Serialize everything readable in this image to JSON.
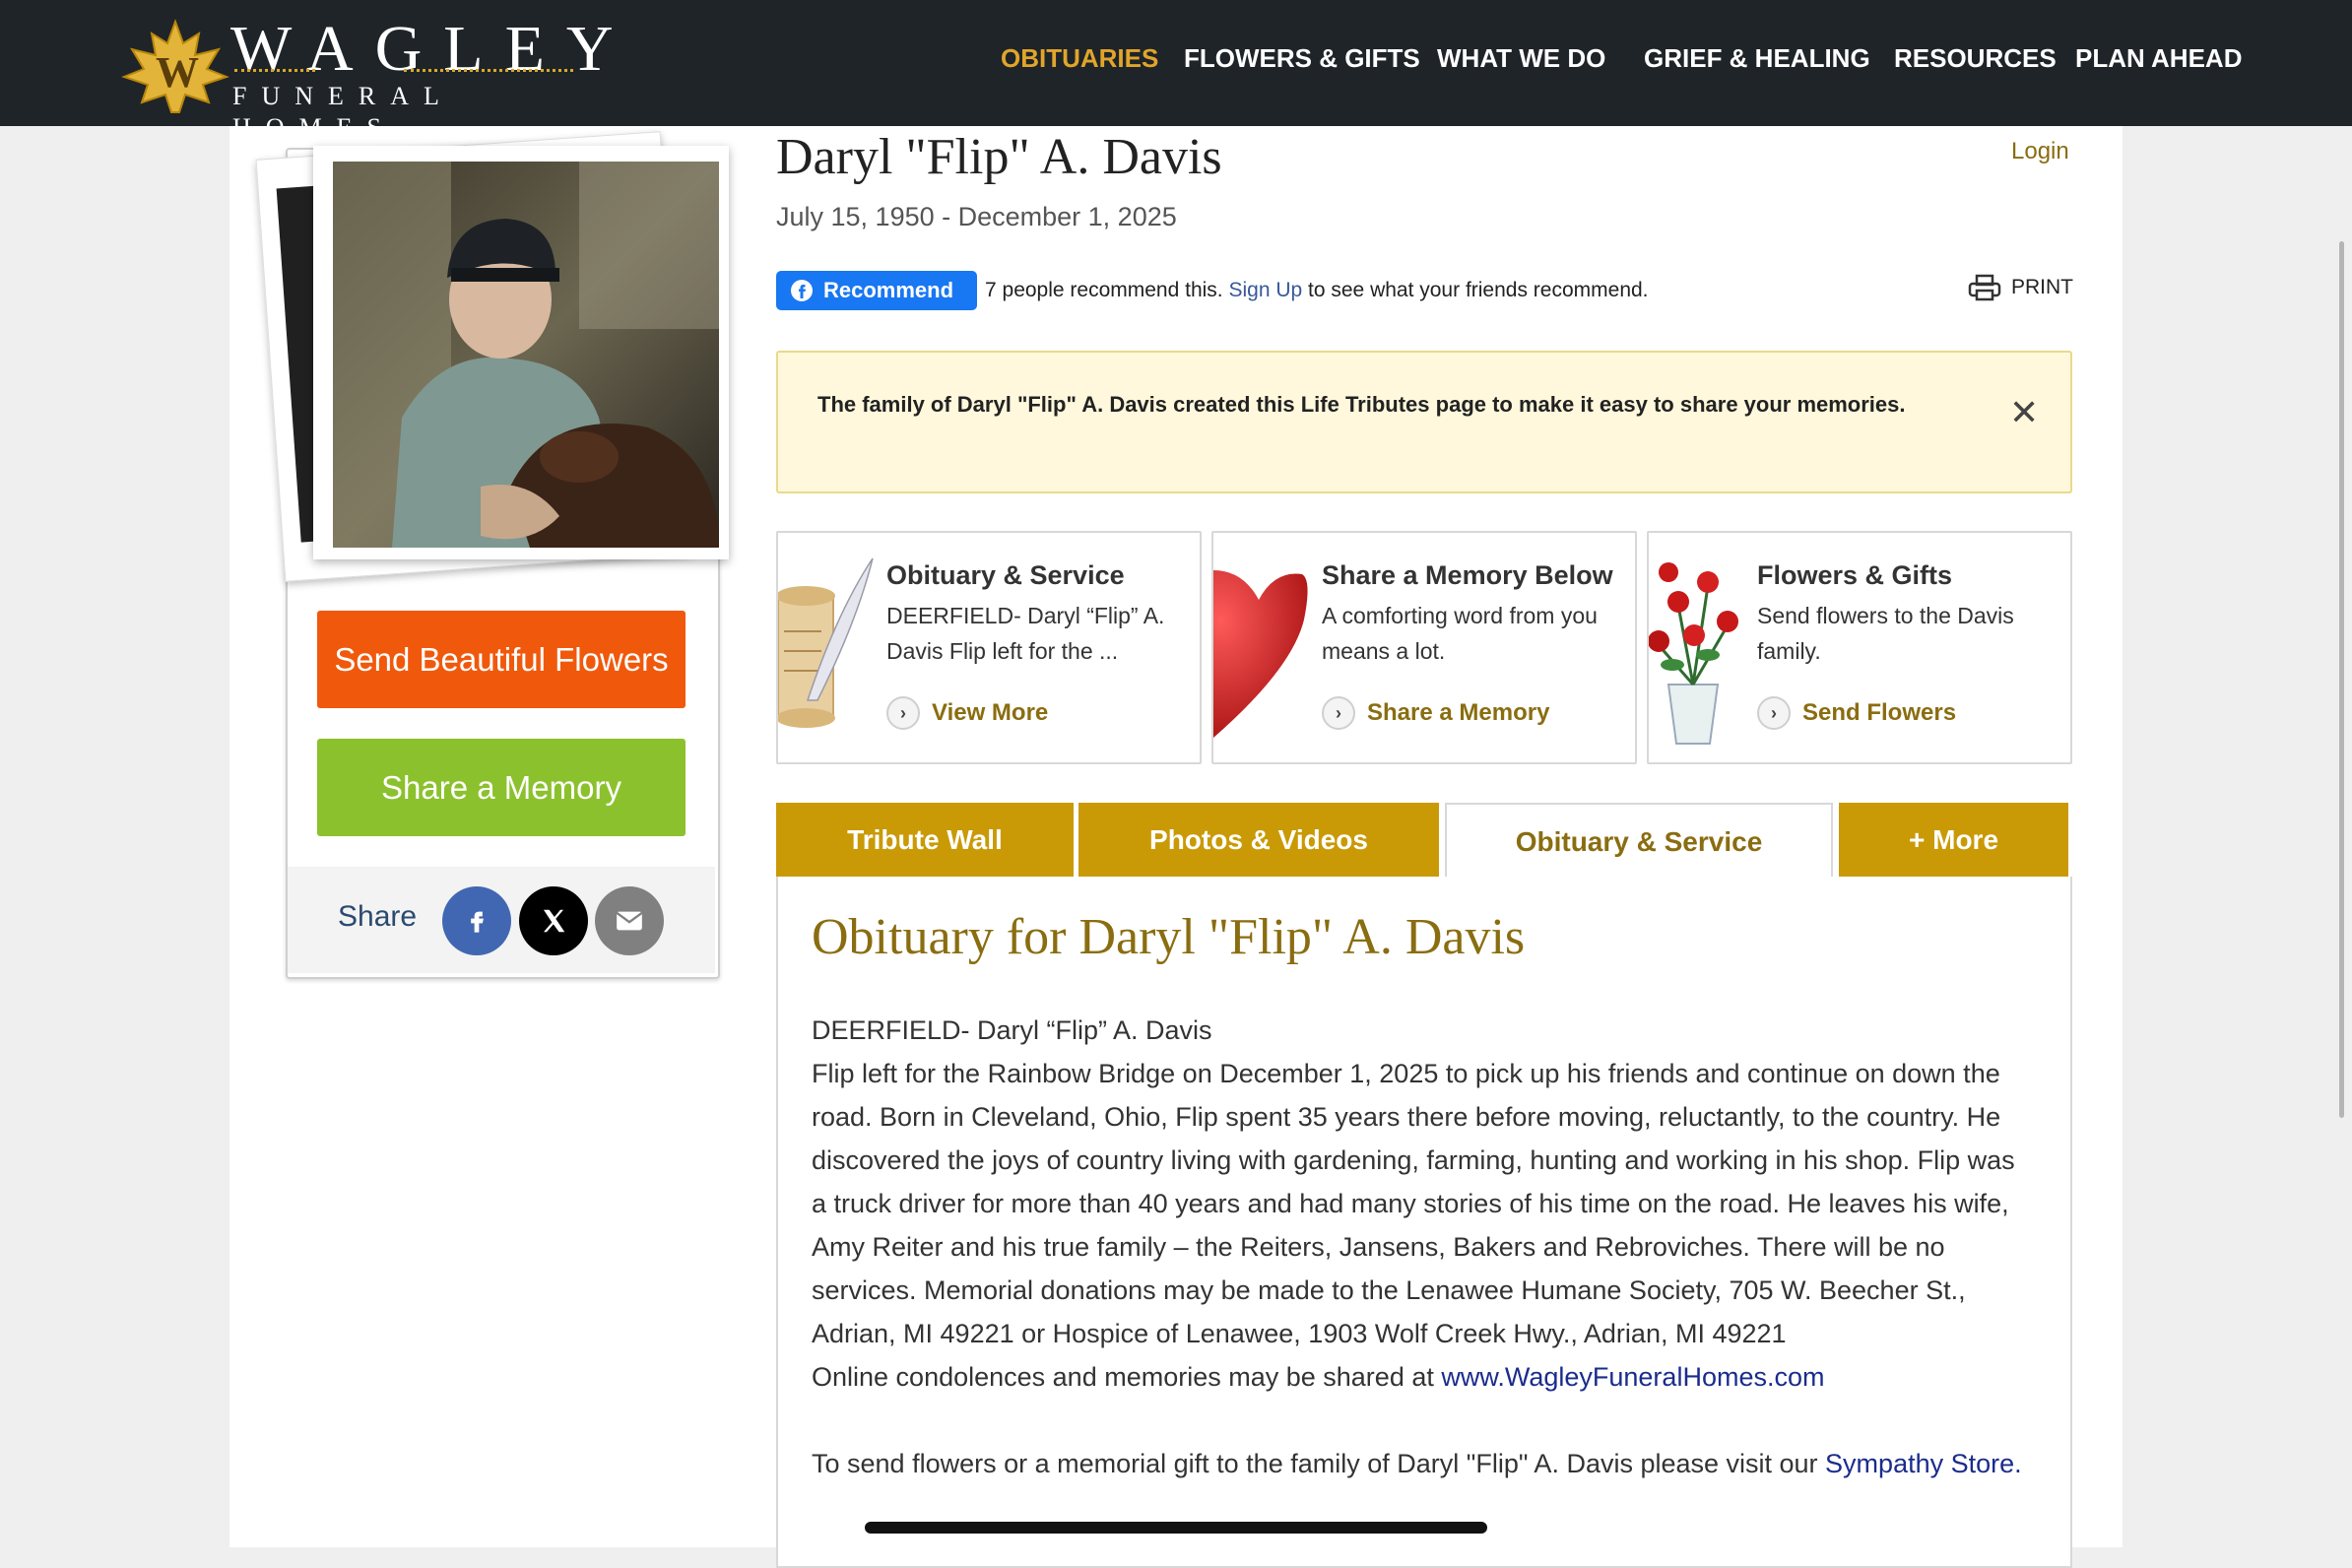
{
  "header": {
    "logo_word": "WAGLEY",
    "logo_sub": "FUNERAL HOMES",
    "logo_letter": "W",
    "nav": [
      "OBITUARIES",
      "FLOWERS & GIFTS",
      "WHAT WE DO",
      "GRIEF & HEALING",
      "RESOURCES",
      "PLAN AHEAD"
    ],
    "nav_active": "OBITUARIES"
  },
  "sidebar": {
    "send_flowers": "Send Beautiful Flowers",
    "share_memory": "Share a Memory",
    "share_label": "Share",
    "share_icons": [
      "facebook-icon",
      "x-icon",
      "email-icon"
    ]
  },
  "profile": {
    "name": "Daryl \"Flip\" A. Davis",
    "dates": "July 15, 1950 - December 1, 2025",
    "login": "Login"
  },
  "recommend": {
    "button": "Recommend",
    "text_before": "7 people recommend this. ",
    "link": "Sign Up",
    "text_after": " to see what your friends recommend.",
    "print": "PRINT"
  },
  "notice": {
    "text": "The family of Daryl \"Flip\" A. Davis created this Life Tributes page to make it easy to share your memories.",
    "close": "✕"
  },
  "cards": [
    {
      "title": "Obituary & Service",
      "desc": "DEERFIELD- Daryl “Flip” A. Davis Flip left for the ...",
      "link": "View More"
    },
    {
      "title": "Share a Memory Below",
      "desc": "A comforting word from you means a lot.",
      "link": "Share a Memory"
    },
    {
      "title": "Flowers & Gifts",
      "desc": "Send flowers to the Davis family.",
      "link": "Send Flowers"
    }
  ],
  "tabs": [
    "Tribute Wall",
    "Photos & Videos",
    "Obituary & Service",
    "+ More"
  ],
  "tab_active": "Obituary & Service",
  "obituary": {
    "heading": "Obituary for Daryl \"Flip\" A. Davis",
    "line1": "DEERFIELD- Daryl “Flip” A. Davis",
    "body": "Flip left for the Rainbow Bridge on December 1, 2025 to pick up his friends and continue on down the road. Born in Cleveland, Ohio, Flip spent 35 years there before moving, reluctantly, to the country. He discovered the joys of country living with gardening, farming, hunting and working in his shop. Flip was a truck driver for more than 40 years and had many stories of his time on the road. He leaves his wife, Amy Reiter and his true family – the Reiters, Jansens, Bakers and Rebroviches. There will be no services. Memorial donations may be made to the Lenawee Humane Society, 705 W. Beecher St., Adrian, MI 49221 or Hospice of Lenawee, 1903 Wolf Creek Hwy., Adrian, MI 49221",
    "online_text": "Online condolences and memories may be shared at ",
    "online_link": "www.WagleyFuneralHomes.com",
    "closing_text": "To send flowers or a memorial gift to the family of Daryl \"Flip\" A. Davis please visit our ",
    "closing_link": "Sympathy Store",
    "closing_end": "."
  },
  "colors": {
    "header_bg": "#1f2429",
    "accent_gold": "#c99a06",
    "nav_active": "#e0a52a",
    "flowers_button": "#f0590c",
    "memory_button": "#8cc12e",
    "facebook": "#4267b2",
    "link_blue": "#1a2c8c"
  }
}
